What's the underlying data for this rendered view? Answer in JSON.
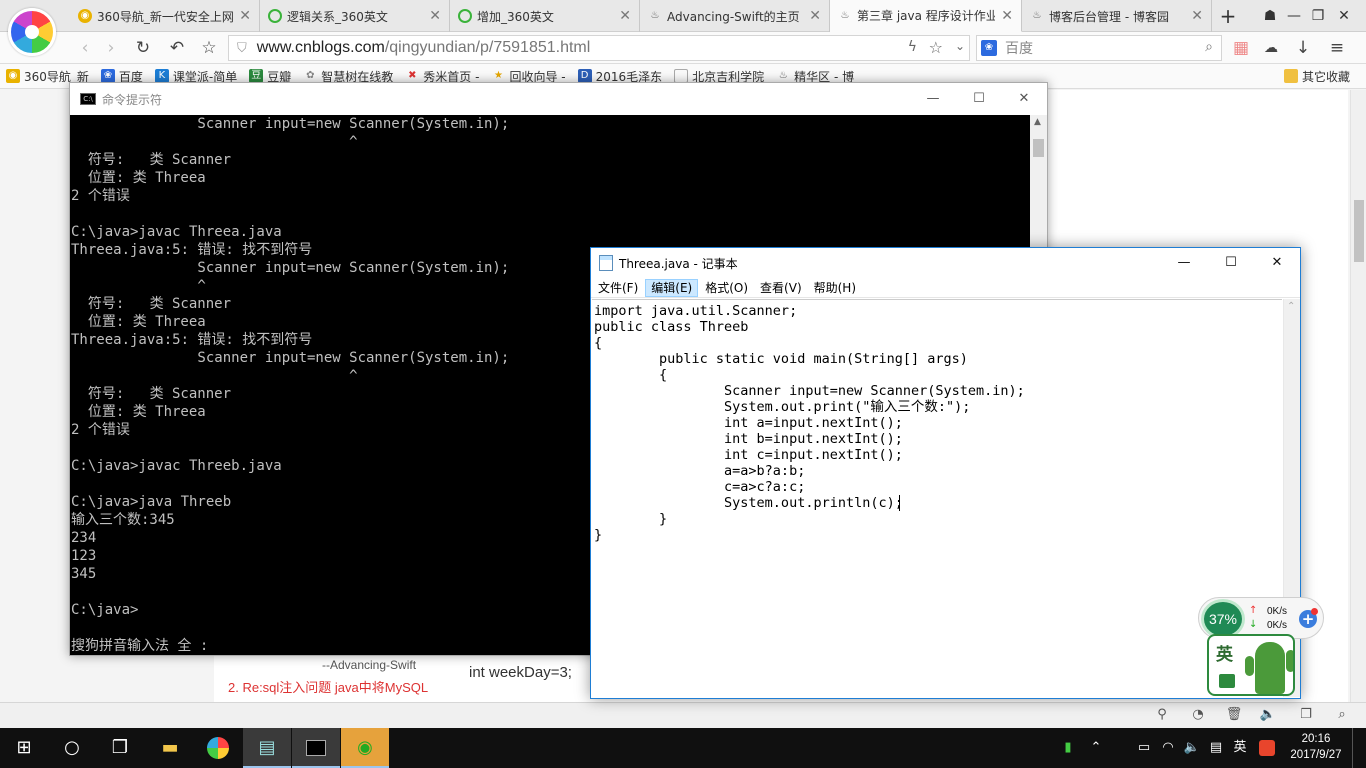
{
  "browser": {
    "tabs": [
      {
        "label": "360导航_新一代安全上网",
        "icon": "360-nav-icon"
      },
      {
        "label": "逻辑关系_360英文",
        "icon": "360-search-icon"
      },
      {
        "label": "增加_360英文",
        "icon": "360-search-icon"
      },
      {
        "label": "Advancing-Swift的主页",
        "icon": "cnblogs-icon"
      },
      {
        "label": "第三章 java 程序设计作业",
        "icon": "cnblogs-icon",
        "active": true
      },
      {
        "label": "博客后台管理 - 博客园",
        "icon": "cnblogs-icon"
      }
    ],
    "url_domain": "www.cnblogs.com",
    "url_path": "/qingyundian/p/7591851.html",
    "search_placeholder": "百度",
    "bookmarks": [
      {
        "label": "360导航_新",
        "icon": "360-icon"
      },
      {
        "label": "百度",
        "icon": "baidu-icon"
      },
      {
        "label": "课堂派-简单",
        "icon": "ketangpai-icon"
      },
      {
        "label": "豆瓣",
        "icon": "douban-icon"
      },
      {
        "label": "智慧树在线教",
        "icon": "zhihuishu-icon"
      },
      {
        "label": "秀米首页 -",
        "icon": "xiumi-icon"
      },
      {
        "label": "回收向导 -",
        "icon": "star-icon"
      },
      {
        "label": "2016毛泽东",
        "icon": "doc-icon"
      },
      {
        "label": "北京吉利学院",
        "icon": "page-icon"
      },
      {
        "label": "精华区 - 博",
        "icon": "cnblogs-icon"
      }
    ],
    "bookmarks_other": "其它收藏"
  },
  "page": {
    "author_ref": "--Advancing-Swift",
    "comment_link": "2. Re:sql注入问题 java中将MySQL",
    "code_line": "int weekDay=3;"
  },
  "cmd": {
    "title": "命令提示符",
    "lines": [
      "               Scanner input=new Scanner(System.in);",
      "                                 ^",
      "  符号:   类 Scanner",
      "  位置: 类 Threea",
      "2 个错误",
      "",
      "C:\\java>javac Threea.java",
      "Threea.java:5: 错误: 找不到符号",
      "               Scanner input=new Scanner(System.in);",
      "               ^",
      "  符号:   类 Scanner",
      "  位置: 类 Threea",
      "Threea.java:5: 错误: 找不到符号",
      "               Scanner input=new Scanner(System.in);",
      "                                 ^",
      "  符号:   类 Scanner",
      "  位置: 类 Threea",
      "2 个错误",
      "",
      "C:\\java>javac Threeb.java",
      "",
      "C:\\java>java Threeb",
      "输入三个数:345",
      "234",
      "123",
      "345",
      "",
      "C:\\java>",
      "",
      "搜狗拼音输入法 全 :"
    ]
  },
  "notepad": {
    "title": "Threea.java - 记事本",
    "menu": [
      "文件(F)",
      "编辑(E)",
      "格式(O)",
      "查看(V)",
      "帮助(H)"
    ],
    "lines": [
      "import java.util.Scanner;",
      "public class Threeb",
      "{",
      "        public static void main(String[] args)",
      "        {",
      "                Scanner input=new Scanner(System.in);",
      "                System.out.print(\"输入三个数:\");",
      "                int a=input.nextInt();",
      "                int b=input.nextInt();",
      "                int c=input.nextInt();",
      "                a=a>b?a:b;",
      "                c=a>c?a:c;",
      "                System.out.println(c);",
      "        }",
      "}"
    ]
  },
  "widget360": {
    "percent": "37%",
    "up": "0K/s",
    "down": "0K/s"
  },
  "ime_tray_char": "英",
  "taskbar": {
    "time": "20:16",
    "date": "2017/9/27",
    "lang": "英"
  }
}
